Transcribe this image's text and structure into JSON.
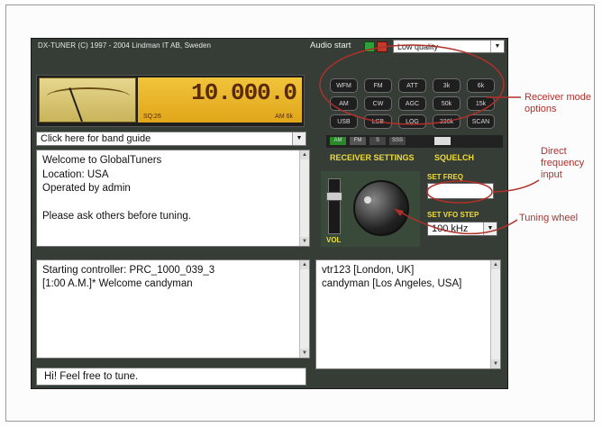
{
  "titlebar": {
    "title": "DX-TUNER (C) 1997 - 2004 Lindman IT AB, Sweden",
    "audio_label": "Audio start",
    "quality": "Low quality"
  },
  "display": {
    "frequency": "10.000.0",
    "squelch": "SQ:26",
    "mode": "AM   6k"
  },
  "mode_buttons": [
    "WFM",
    "FM",
    "ATT",
    "3k",
    "6k",
    "AM",
    "CW",
    "AGC",
    "50k",
    "15k",
    "USB",
    "LSB",
    "LOG",
    "230k",
    "SCAN"
  ],
  "indicators": [
    "AM",
    "FM",
    "S",
    "SSS",
    ""
  ],
  "band_guide": "Click here for band guide",
  "info_lines": [
    "Welcome to GlobalTuners",
    "Location: USA",
    "Operated by  admin",
    "",
    "Please ask others before tuning."
  ],
  "controls": {
    "receiver_settings": "RECEIVER SETTINGS",
    "squelch": "SQUELCH",
    "vol": "VOL",
    "set_freq": "SET FREQ",
    "set_vfo_step": "SET VFO STEP",
    "vfo_step": "100 kHz"
  },
  "chat_lines": [
    "Starting controller: PRC_1000_039_3",
    "[1:00 A.M.]* Welcome candyman"
  ],
  "users": [
    "vtr123 [London, UK]",
    "candyman [Los Angeles, USA]"
  ],
  "chat_input": "Hi!  Feel free to tune.",
  "annotations": {
    "receiver_modes": "Receiver mode options",
    "direct_freq": "Direct frequency input",
    "tuning_wheel": "Tuning wheel"
  }
}
